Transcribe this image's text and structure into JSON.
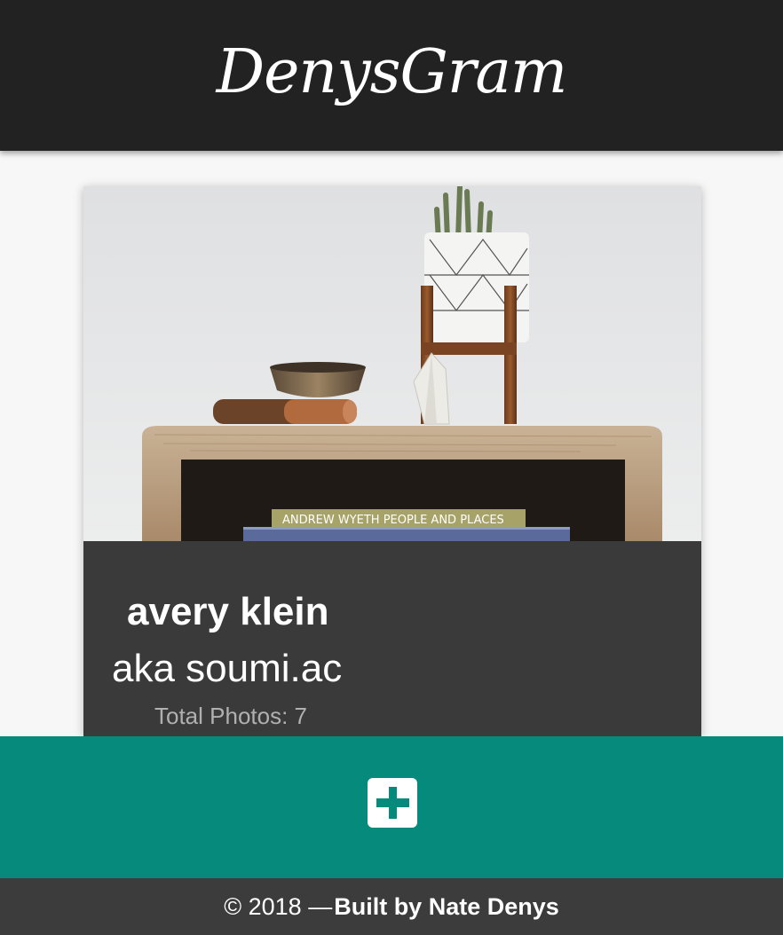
{
  "header": {
    "brand": "DenysGram"
  },
  "profile": {
    "name": "avery klein",
    "alias": "aka soumi.ac",
    "total_photos": "Total Photos: 7",
    "photo_book_title": "ANDREW WYETH  PEOPLE AND PLACES"
  },
  "action_bar": {
    "add_icon": "plus-square-icon"
  },
  "footer": {
    "copyright": "© 2018 —",
    "credit": "Built by Nate Denys"
  },
  "colors": {
    "header_bg": "#222222",
    "page_bg": "#f7f7f7",
    "card_bg": "#3a3a3a",
    "accent_teal": "#068a7b",
    "footer_bg": "#3c3c3c"
  }
}
